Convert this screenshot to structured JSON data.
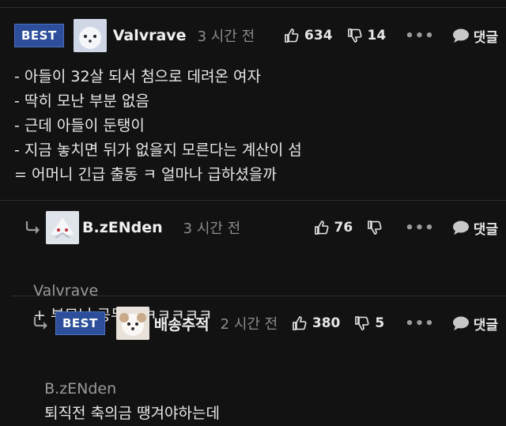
{
  "comments": [
    {
      "badge": "BEST",
      "nickname": "Valvrave",
      "time": "3 시간 전",
      "likes": "634",
      "dislikes": "14",
      "more": "•••",
      "reply_label": "댓글",
      "lines": [
        "- 아들이 32살 되서 첨으로 데려온 여자",
        "- 딱히 모난 부분 없음",
        "- 근데 아들이 둔탱이",
        "- 지금 놓치면 뒤가 없을지 모른다는 계산이 섬",
        "= 어머니 긴급 출동 ㅋ 얼마나 급하셨을까"
      ]
    },
    {
      "nickname": "B.zENden",
      "time": "3 시간 전",
      "likes": "76",
      "dislikes": "",
      "more": "•••",
      "reply_label": "댓글",
      "mention": "Valvrave",
      "text": "+ 부모님 공무원 ㅋㅋㅋㅋㅋ"
    },
    {
      "badge": "BEST",
      "nickname": "배송추적",
      "time": "2 시간 전",
      "likes": "380",
      "dislikes": "5",
      "more": "•••",
      "reply_label": "댓글",
      "mention": "B.zENden",
      "text": "퇴직전 축의금 땡겨야하는데"
    }
  ],
  "colors": {
    "badge_bg": "#2d4e9b",
    "background": "#121212",
    "muted_text": "#8d8d8d"
  },
  "icons": [
    "thumbs-up-icon",
    "thumbs-down-icon",
    "more-dots-icon",
    "speech-bubble-icon",
    "reply-arrow-icon"
  ]
}
